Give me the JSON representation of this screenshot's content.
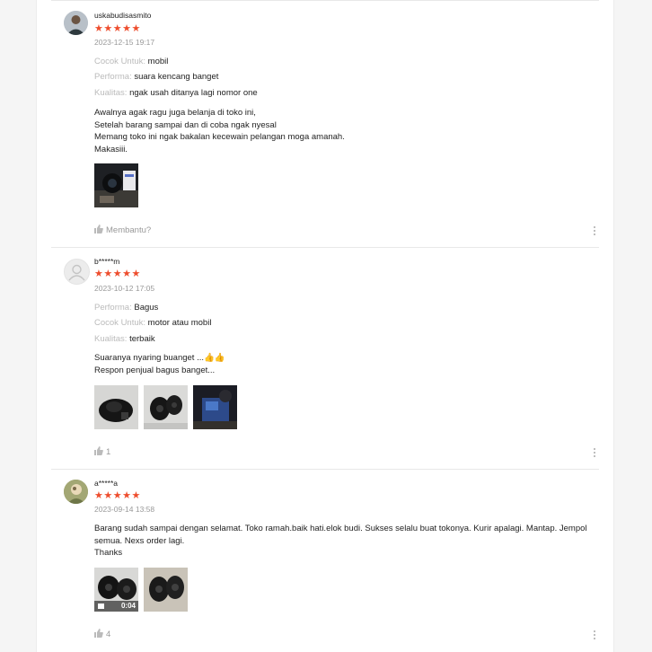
{
  "reviews": [
    {
      "username": "uskabudisasmito",
      "stars": "★★★★★",
      "date": "2023-12-15 19:17",
      "attributes": [
        {
          "key": "Cocok Untuk:",
          "value": "mobil"
        },
        {
          "key": "Performa:",
          "value": "suara kencang banget"
        },
        {
          "key": "Kualitas:",
          "value": "ngak usah ditanya lagi nomor one"
        }
      ],
      "comment_lines": [
        "Awalnya agak ragu juga belanja di toko ini,",
        "Setelah barang sampai dan di coba ngak nyesal",
        "Memang toko ini ngak bakalan kecewain pelangan moga amanah.",
        "Makasiii."
      ],
      "helpful_label": "Membantu?"
    },
    {
      "username": "b*****m",
      "stars": "★★★★★",
      "date": "2023-10-12 17:05",
      "attributes": [
        {
          "key": "Performa:",
          "value": "Bagus"
        },
        {
          "key": "Cocok Untuk:",
          "value": "motor atau mobil"
        },
        {
          "key": "Kualitas:",
          "value": "terbaik"
        }
      ],
      "comment_lines": [
        "Suaranya nyaring buanget ...👍👍",
        "Respon penjual bagus banget..."
      ],
      "helpful_label": "1"
    },
    {
      "username": "a*****a",
      "stars": "★★★★★",
      "date": "2023-09-14 13:58",
      "comment_lines": [
        "Barang sudah sampai dengan selamat. Toko ramah.baik hati.elok budi. Sukses selalu buat tokonya. Kurir apalagi. Mantap. Jempol",
        "semua. Nexs order lagi.",
        "Thanks"
      ],
      "video_duration": "0:04",
      "helpful_label": "4"
    }
  ],
  "colors": {
    "star": "#ee4d2d",
    "muted": "#999999",
    "attr_key": "#bbbbbb"
  },
  "icons": {
    "helpful": "thumbs-up-icon",
    "more": "more-vertical-icon",
    "video": "video-camera-icon"
  }
}
